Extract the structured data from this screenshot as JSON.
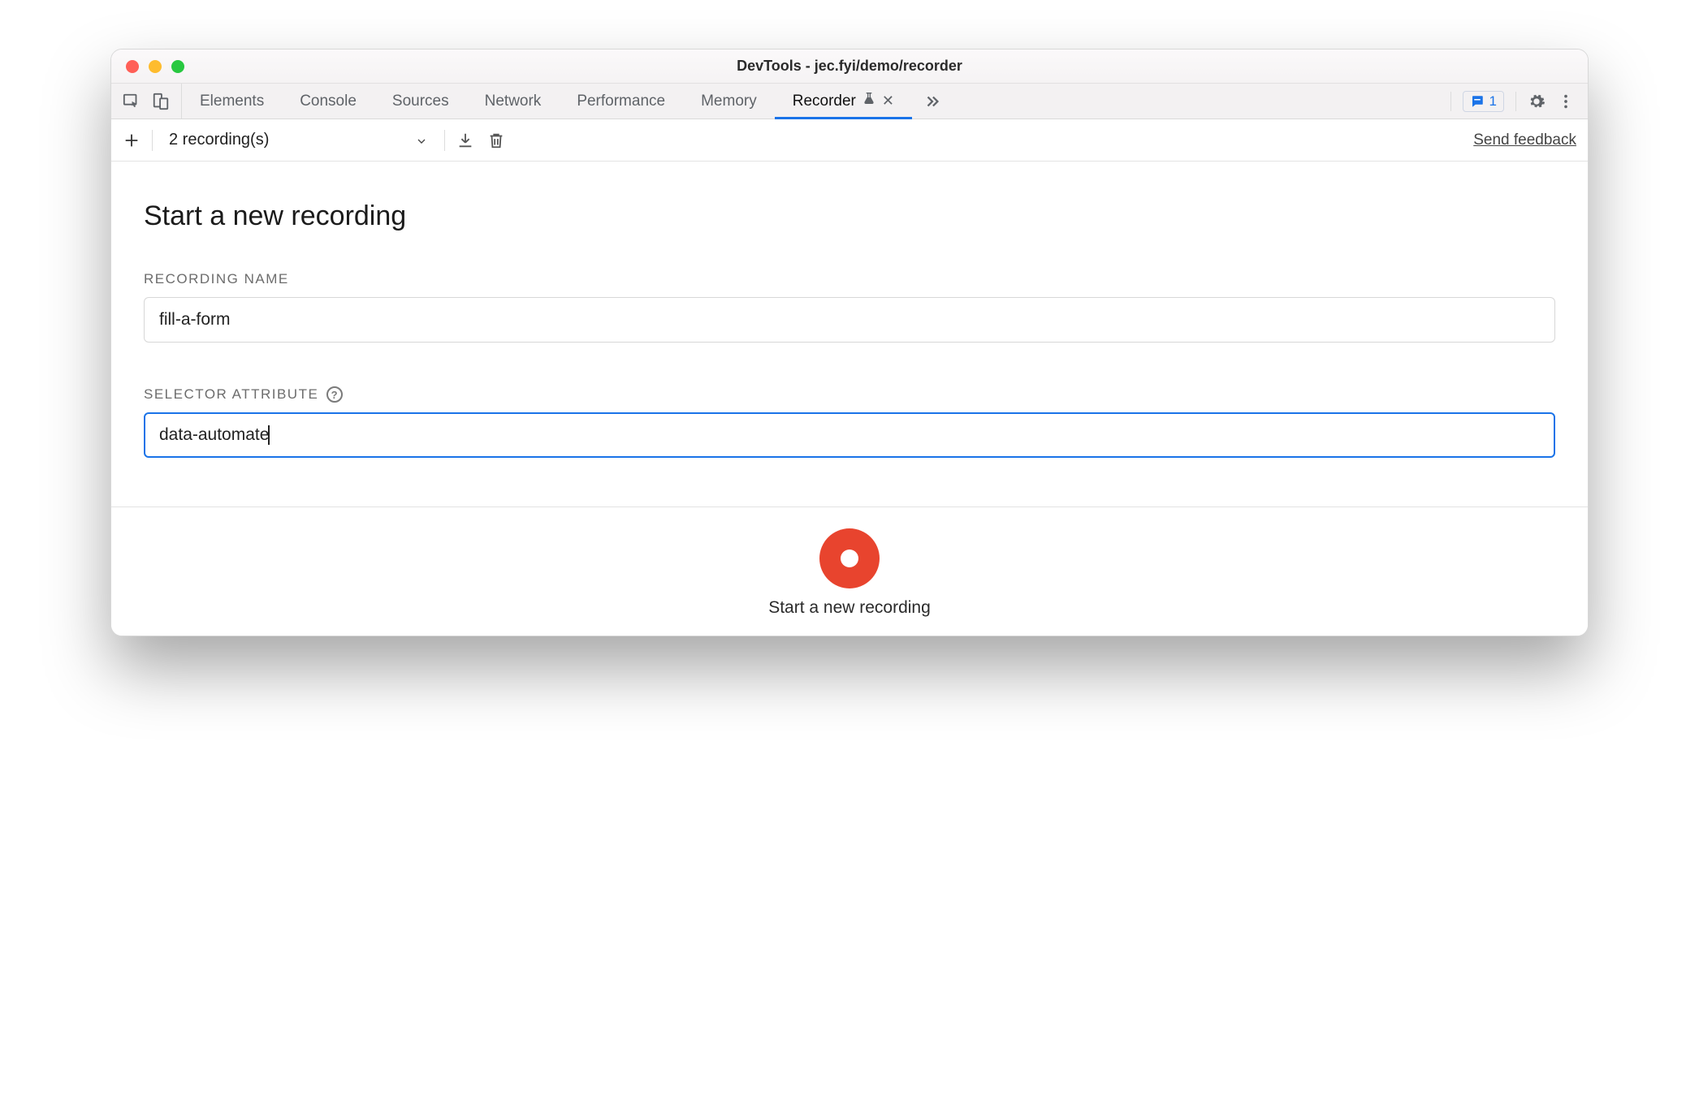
{
  "window": {
    "title": "DevTools - jec.fyi/demo/recorder"
  },
  "tabs": {
    "items": [
      {
        "label": "Elements"
      },
      {
        "label": "Console"
      },
      {
        "label": "Sources"
      },
      {
        "label": "Network"
      },
      {
        "label": "Performance"
      },
      {
        "label": "Memory"
      },
      {
        "label": "Recorder",
        "active": true,
        "experimental": true,
        "closable": true
      }
    ]
  },
  "issues": {
    "count": "1"
  },
  "toolbar": {
    "dropdown_label": "2 recording(s)",
    "feedback_label": "Send feedback"
  },
  "main": {
    "heading": "Start a new recording",
    "recording_name_label": "RECORDING NAME",
    "recording_name_value": "fill-a-form",
    "selector_attr_label": "SELECTOR ATTRIBUTE",
    "selector_attr_value": "data-automate"
  },
  "footer": {
    "record_label": "Start a new recording"
  }
}
